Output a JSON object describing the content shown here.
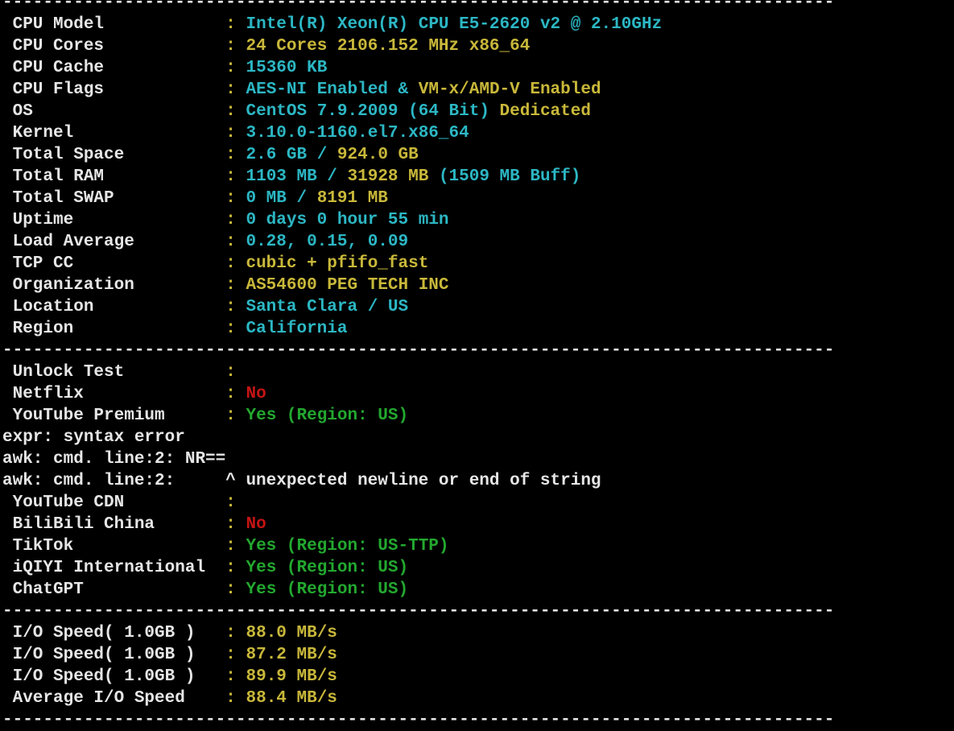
{
  "terminal": {
    "colors": {
      "background": "#000000",
      "text": "#e6e6e6",
      "cyan": "#2cb7c4",
      "yellow": "#c9b83a",
      "red": "#c51414",
      "green": "#23a82f"
    },
    "separator": "----------------------------------------------------------------------------------",
    "system_info": [
      {
        "label": " CPU Model",
        "value": "Intel(R) Xeon(R) CPU E5-2620 v2 @ 2.10GHz",
        "color": "cyan"
      },
      {
        "label": " CPU Cores",
        "value": "24 Cores 2106.152 MHz x86_64",
        "color": "yellow"
      },
      {
        "label": " CPU Cache",
        "value": "15360 KB",
        "color": "cyan"
      },
      {
        "label": " CPU Flags",
        "value_parts": [
          {
            "text": "AES-NI Enabled & ",
            "color": "cyan"
          },
          {
            "text": "VM-x/AMD-V Enabled",
            "color": "yellow"
          }
        ]
      },
      {
        "label": " OS",
        "value_parts": [
          {
            "text": "CentOS 7.9.2009 (64 Bit) ",
            "color": "cyan"
          },
          {
            "text": "Dedicated",
            "color": "yellow"
          }
        ]
      },
      {
        "label": " Kernel",
        "value": "3.10.0-1160.el7.x86_64",
        "color": "cyan"
      },
      {
        "label": " Total Space",
        "value_parts": [
          {
            "text": "2.6 GB / ",
            "color": "cyan"
          },
          {
            "text": "924.0 GB",
            "color": "yellow"
          }
        ]
      },
      {
        "label": " Total RAM",
        "value_parts": [
          {
            "text": "1103 MB / ",
            "color": "cyan"
          },
          {
            "text": "31928 MB",
            "color": "yellow"
          },
          {
            "text": " (1509 MB Buff)",
            "color": "cyan"
          }
        ]
      },
      {
        "label": " Total SWAP",
        "value_parts": [
          {
            "text": "0 MB / ",
            "color": "cyan"
          },
          {
            "text": "8191 MB",
            "color": "yellow"
          }
        ]
      },
      {
        "label": " Uptime",
        "value": "0 days 0 hour 55 min",
        "color": "cyan"
      },
      {
        "label": " Load Average",
        "value": "0.28, 0.15, 0.09",
        "color": "cyan"
      },
      {
        "label": " TCP CC",
        "value": "cubic + pfifo_fast",
        "color": "yellow"
      },
      {
        "label": " Organization",
        "value": "AS54600 PEG TECH INC",
        "color": "yellow"
      },
      {
        "label": " Location",
        "value": "Santa Clara / US",
        "color": "cyan"
      },
      {
        "label": " Region",
        "value": "California",
        "color": "cyan"
      }
    ],
    "unlock_test": [
      {
        "type": "kv",
        "label": " Unlock Test",
        "value": "",
        "color": "white"
      },
      {
        "type": "kv",
        "label": " Netflix",
        "value": "No",
        "color": "red"
      },
      {
        "type": "kv",
        "label": " YouTube Premium",
        "value": "Yes (Region: US)",
        "color": "green"
      },
      {
        "type": "raw",
        "text": "expr: syntax error"
      },
      {
        "type": "raw",
        "text": "awk: cmd. line:2: NR=="
      },
      {
        "type": "raw",
        "text": "awk: cmd. line:2:     ^ unexpected newline or end of string"
      },
      {
        "type": "kv",
        "label": " YouTube CDN",
        "value": "",
        "color": "white"
      },
      {
        "type": "kv",
        "label": " BiliBili China",
        "value": "No",
        "color": "red"
      },
      {
        "type": "kv",
        "label": " TikTok",
        "value": "Yes (Region: US-TTP)",
        "color": "green"
      },
      {
        "type": "kv",
        "label": " iQIYI International",
        "value": "Yes (Region: US)",
        "color": "green"
      },
      {
        "type": "kv",
        "label": " ChatGPT",
        "value": "Yes (Region: US)",
        "color": "green"
      }
    ],
    "io_speed": [
      {
        "label": " I/O Speed( 1.0GB )",
        "value": "88.0 MB/s",
        "color": "yellow"
      },
      {
        "label": " I/O Speed( 1.0GB )",
        "value": "87.2 MB/s",
        "color": "yellow"
      },
      {
        "label": " I/O Speed( 1.0GB )",
        "value": "89.9 MB/s",
        "color": "yellow"
      },
      {
        "label": " Average I/O Speed",
        "value": "88.4 MB/s",
        "color": "yellow"
      }
    ]
  }
}
